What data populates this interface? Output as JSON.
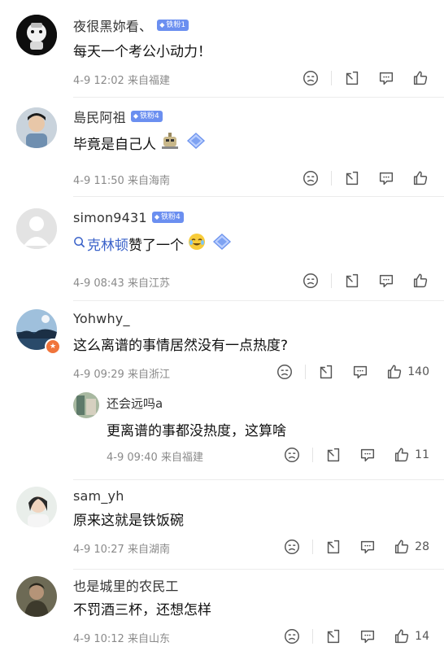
{
  "comments": [
    {
      "user": "夜很黑妳看、",
      "badge": "铁粉1",
      "text": "每天一个考公小动力！",
      "time": "4-9 12:02",
      "location": "来自福建",
      "likes": ""
    },
    {
      "user": "島民阿祖",
      "badge": "铁粉4",
      "text": "毕竟是自己人",
      "time": "4-9 11:50",
      "location": "来自海南",
      "likes": ""
    },
    {
      "user": "simon9431",
      "badge": "铁粉4",
      "link": "克林顿",
      "text": "赞了一个",
      "time": "4-9 08:43",
      "location": "来自江苏",
      "likes": ""
    },
    {
      "user": "Yohwhy_",
      "text": "这么离谱的事情居然没有一点热度?",
      "time": "4-9 09:29",
      "location": "来自浙江",
      "likes": "140",
      "reply": {
        "user": "还会远吗a",
        "text": "更离谱的事都没热度，这算啥",
        "time": "4-9 09:40",
        "location": "来自福建",
        "likes": "11"
      }
    },
    {
      "user": "sam_yh",
      "text": "原来这就是铁饭碗",
      "time": "4-9 10:27",
      "location": "来自湖南",
      "likes": "28"
    },
    {
      "user": "也是城里的农民工",
      "text": "不罚酒三杯，还想怎样",
      "time": "4-9 10:12",
      "location": "来自山东",
      "likes": "14"
    }
  ],
  "icons": {
    "dislike": "sad-face-icon",
    "share": "share-icon",
    "comment": "comment-icon",
    "like": "thumbs-up-icon",
    "badge": "diamond-icon"
  },
  "colors": {
    "badge": "#6b8ff0",
    "link": "#3a62c9",
    "meta": "#8a8a8a"
  }
}
